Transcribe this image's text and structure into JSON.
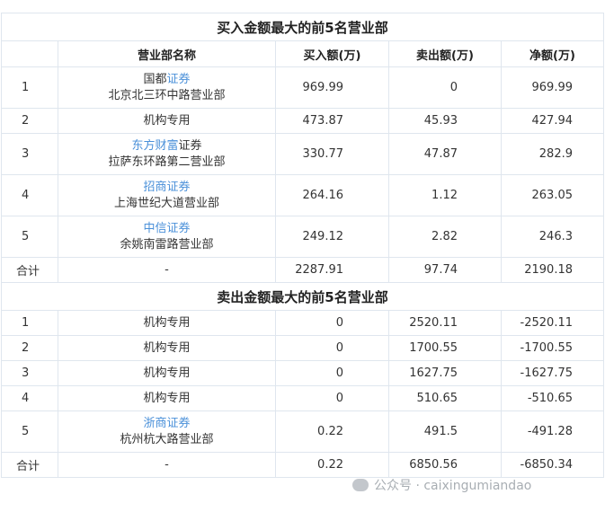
{
  "buy_section": {
    "title": "买入金额最大的前5名营业部",
    "headers": [
      "营业部名称",
      "买入额(万)",
      "卖出额(万)",
      "净额(万)"
    ],
    "rows": [
      {
        "rank": "1",
        "name_blue_pre": "",
        "name_black_pre": "国都",
        "name_blue": "证券",
        "name_black": "",
        "branch": "北京北三环中路营业部",
        "buy": "969.99",
        "sell": "0",
        "net": "969.99"
      },
      {
        "rank": "2",
        "name_blue_pre": "",
        "name_black_pre": "",
        "name_blue": "",
        "name_black": "机构专用",
        "branch": "",
        "buy": "473.87",
        "sell": "45.93",
        "net": "427.94"
      },
      {
        "rank": "3",
        "name_blue_pre": "东方财富",
        "name_black_pre": "",
        "name_blue": "",
        "name_black": "证券",
        "branch": "拉萨东环路第二营业部",
        "buy": "330.77",
        "sell": "47.87",
        "net": "282.9"
      },
      {
        "rank": "4",
        "name_blue_pre": "招商证券",
        "name_black_pre": "",
        "name_blue": "",
        "name_black": "",
        "branch": "上海世纪大道营业部",
        "buy": "264.16",
        "sell": "1.12",
        "net": "263.05"
      },
      {
        "rank": "5",
        "name_blue_pre": "中信证券",
        "name_black_pre": "",
        "name_blue": "",
        "name_black": "",
        "branch": "余姚南雷路营业部",
        "buy": "249.12",
        "sell": "2.82",
        "net": "246.3"
      }
    ],
    "total": {
      "label": "合计",
      "name": "-",
      "buy": "2287.91",
      "sell": "97.74",
      "net": "2190.18"
    }
  },
  "sell_section": {
    "title": "卖出金额最大的前5名营业部",
    "rows": [
      {
        "rank": "1",
        "name_blue": "",
        "name_black": "机构专用",
        "branch": "",
        "buy": "0",
        "sell": "2520.11",
        "net": "-2520.11"
      },
      {
        "rank": "2",
        "name_blue": "",
        "name_black": "机构专用",
        "branch": "",
        "buy": "0",
        "sell": "1700.55",
        "net": "-1700.55"
      },
      {
        "rank": "3",
        "name_blue": "",
        "name_black": "机构专用",
        "branch": "",
        "buy": "0",
        "sell": "1627.75",
        "net": "-1627.75"
      },
      {
        "rank": "4",
        "name_blue": "",
        "name_black": "机构专用",
        "branch": "",
        "buy": "0",
        "sell": "510.65",
        "net": "-510.65"
      },
      {
        "rank": "5",
        "name_blue": "浙商证券",
        "name_black": "",
        "branch": "杭州杭大路营业部",
        "buy": "0.22",
        "sell": "491.5",
        "net": "-491.28"
      }
    ],
    "total": {
      "label": "合计",
      "name": "-",
      "buy": "0.22",
      "sell": "6850.56",
      "net": "-6850.34"
    }
  },
  "watermark": {
    "text": "公众号 · caixingumiandao"
  },
  "colors": {
    "link_blue": "#4a90d9",
    "border": "#dfe6ee",
    "text": "#333333"
  }
}
